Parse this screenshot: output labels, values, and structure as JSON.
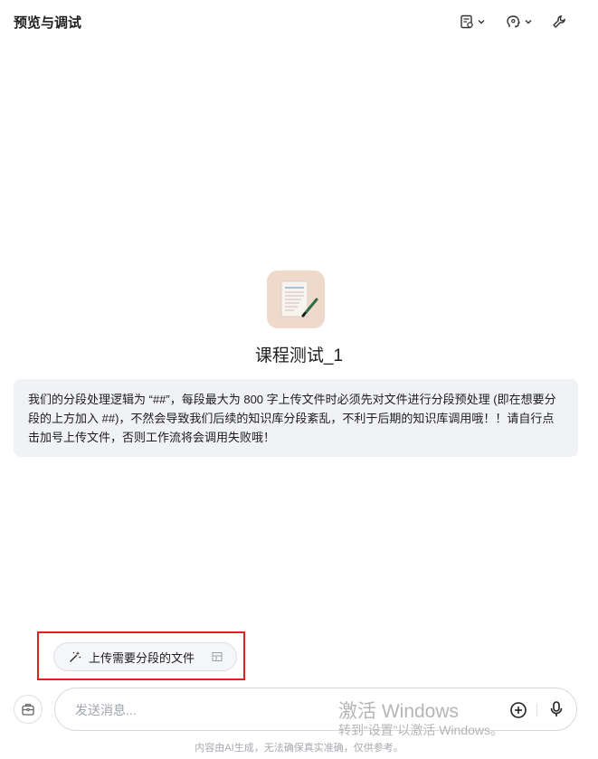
{
  "header": {
    "title": "预览与调试",
    "actions": [
      {
        "icon": "document-settings-icon"
      },
      {
        "icon": "memory-head-icon"
      },
      {
        "icon": "wrench-icon"
      }
    ]
  },
  "bot": {
    "avatar_icon": "notepad-pen-icon",
    "name": "课程测试_1"
  },
  "notice": {
    "text": "我们的分段处理逻辑为 “##”，每段最大为 800 字上传文件时必须先对文件进行分段预处理 (即在想要分段的上方加入 ##)，不然会导致我们后续的知识库分段紊乱，不利于后期的知识库调用哦！！请自行点击加号上传文件，否则工作流将会调用失败哦！"
  },
  "suggestion": {
    "label": "上传需要分段的文件",
    "icon": "magic-wand-icon",
    "highlight_color": "#e0201e"
  },
  "composer": {
    "placeholder": "发送消息...",
    "left_icon": "briefcase-icon",
    "add_icon": "plus-circle-icon",
    "mic_icon": "microphone-icon"
  },
  "watermark": {
    "line1": "激活 Windows",
    "line2": "转到“设置”以激活 Windows。"
  },
  "disclaimer": "内容由AI生成，无法确保真实准确，仅供参考。"
}
